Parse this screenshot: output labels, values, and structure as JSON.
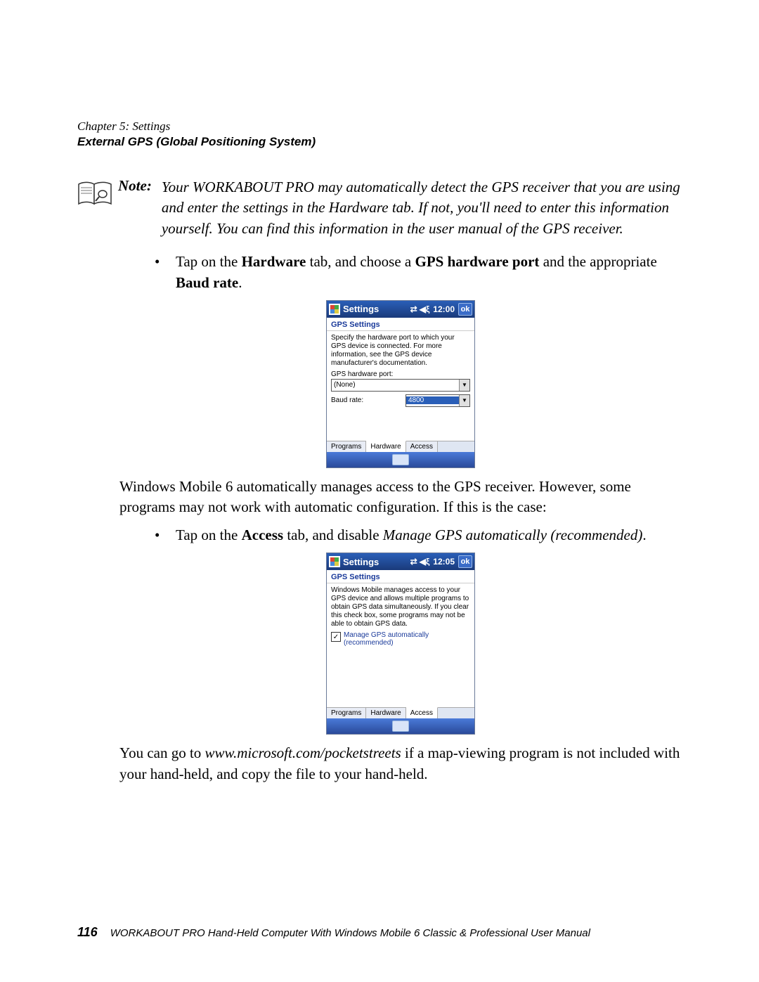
{
  "header": {
    "chapter": "Chapter 5: Settings",
    "section": "External GPS (Global Positioning System)"
  },
  "note": {
    "label": "Note:",
    "text": "Your WORKABOUT PRO may automatically detect the GPS receiver that you are using and enter the settings in the Hardware tab. If not, you'll need to enter this information yourself. You can find this information in the user manual of the GPS receiver."
  },
  "bullet1": {
    "pre": "Tap on the ",
    "b1": "Hardware",
    "mid1": " tab, and choose a ",
    "b2": "GPS hardware port",
    "mid2": " and the appropriate ",
    "b3": "Baud rate",
    "post": "."
  },
  "wm1": {
    "title": "Settings",
    "time": "12:00",
    "ok": "ok",
    "subheader": "GPS Settings",
    "desc": "Specify the hardware port to which your GPS device is connected. For more information, see the GPS device manufacturer's documentation.",
    "port_label": "GPS hardware port:",
    "port_value": "(None)",
    "baud_label": "Baud rate:",
    "baud_value": "4800",
    "tabs": [
      "Programs",
      "Hardware",
      "Access"
    ],
    "active_tab": 1
  },
  "para1": "Windows Mobile 6 automatically manages access to the GPS receiver. However, some programs may not work with automatic configuration. If this is the case:",
  "bullet2": {
    "pre": "Tap on the ",
    "b1": "Access",
    "mid": " tab, and disable ",
    "i1": "Manage GPS automatically (recommended)",
    "post": "."
  },
  "wm2": {
    "title": "Settings",
    "time": "12:05",
    "ok": "ok",
    "subheader": "GPS Settings",
    "desc": "Windows Mobile manages access to your GPS device and allows multiple programs to obtain GPS data simultaneously. If you clear this check box, some programs may not be able to obtain GPS data.",
    "checkbox_checked": true,
    "checkbox_label": "Manage GPS automatically (recommended)",
    "tabs": [
      "Programs",
      "Hardware",
      "Access"
    ],
    "active_tab": 2
  },
  "para2": {
    "pre": "You can go to ",
    "i": "www.microsoft.com/pocketstreets",
    "post": " if a map-viewing program is not included with your hand-held, and copy the file to your hand-held."
  },
  "footer": {
    "page": "116",
    "title": "WORKABOUT PRO Hand-Held Computer With Windows Mobile 6 Classic & Professional User Manual"
  }
}
